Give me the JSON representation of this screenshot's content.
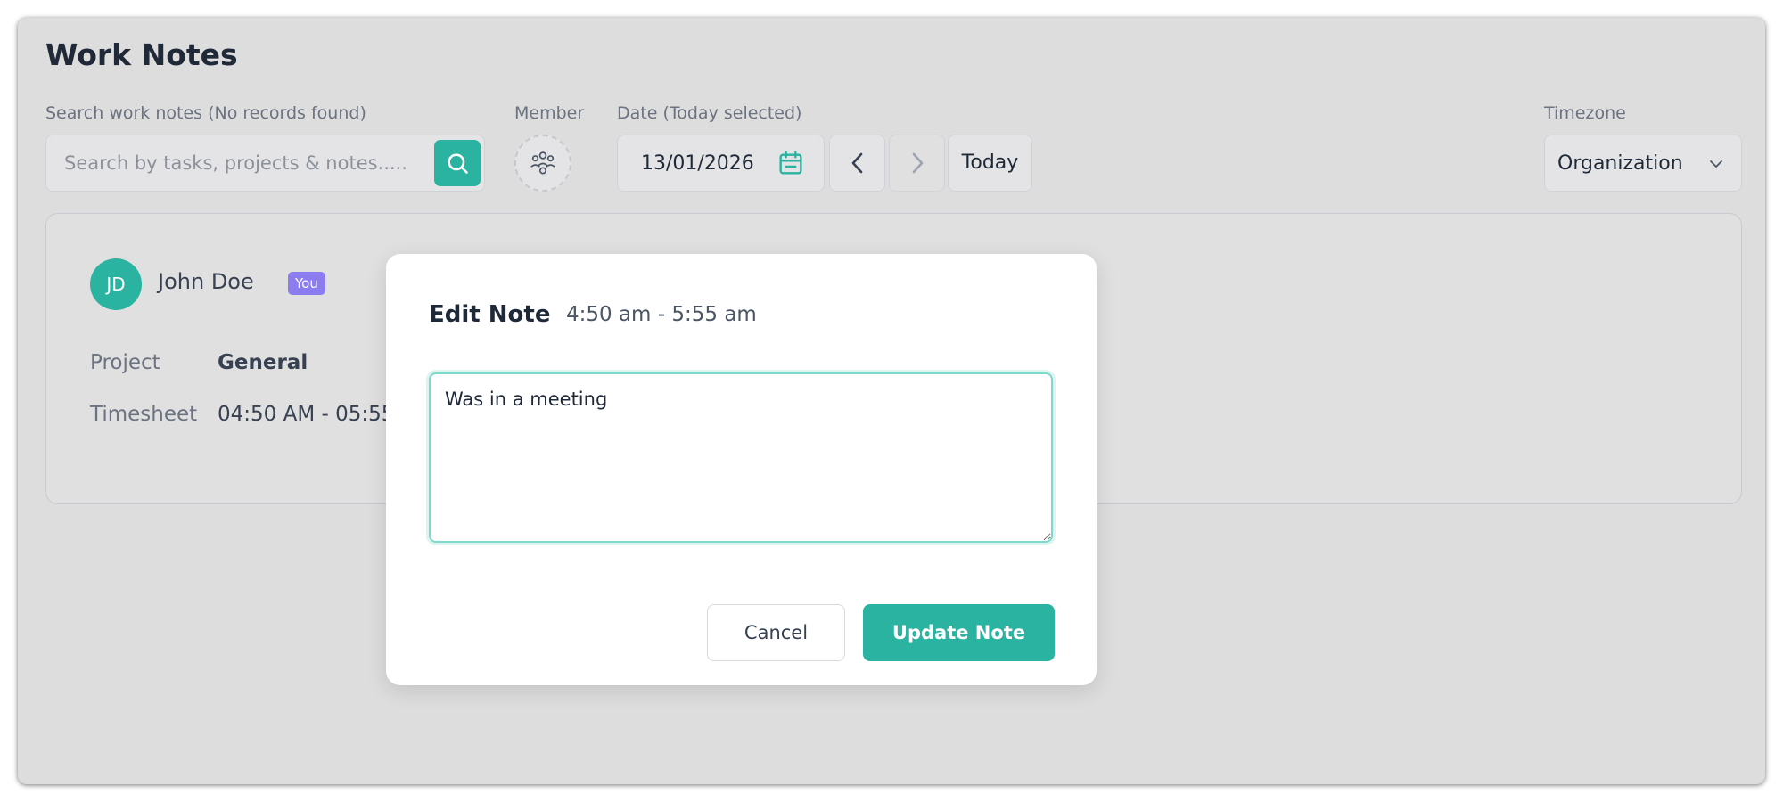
{
  "page": {
    "title": "Work Notes"
  },
  "search": {
    "label": "Search work notes (No records found)",
    "placeholder": "Search by tasks, projects & notes.....",
    "value": ""
  },
  "member": {
    "label": "Member",
    "icon": "users-icon"
  },
  "date": {
    "label": "Date (Today selected)",
    "value": "13/01/2026",
    "today_label": "Today"
  },
  "timezone": {
    "label": "Timezone",
    "value": "Organization"
  },
  "card": {
    "avatar_initials": "JD",
    "user_name": "John Doe",
    "you_badge": "You",
    "project_label": "Project",
    "project_value": "General",
    "timesheet_label": "Timesheet",
    "timesheet_value": "04:50 AM - 05:55"
  },
  "modal": {
    "title": "Edit Note",
    "time_range": "4:50 am - 5:55 am",
    "note_value": "Was in a meeting",
    "cancel_label": "Cancel",
    "update_label": "Update Note"
  },
  "colors": {
    "accent": "#2ab3a0",
    "badge": "#8b7cf0",
    "overlay_bg": "#dddddd"
  }
}
